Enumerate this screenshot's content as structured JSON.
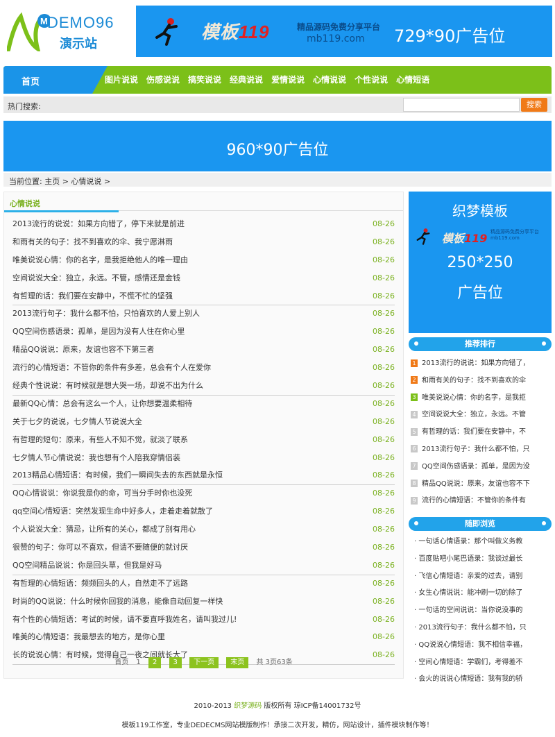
{
  "logo": {
    "brand": "DEMO96",
    "sub": "演示站"
  },
  "top_ad": {
    "mb_prefix": "模板",
    "mb_num": "119",
    "site_line1": "精品源码免费分享平台",
    "site_line2": "mb119.com",
    "size": "729*90广告位"
  },
  "nav": {
    "home": "首页",
    "items": [
      "图片说说",
      "伤感说说",
      "搞笑说说",
      "经典说说",
      "爱情说说",
      "心情说说",
      "个性说说",
      "心情短语"
    ]
  },
  "search": {
    "label": "热门搜索:",
    "button": "搜索"
  },
  "mid_ad": "960*90广告位",
  "breadcrumb": "当前位置: 主页 > 心情说说 >",
  "list": {
    "title": "心情说说",
    "items": [
      {
        "t": "2013流行的说说：如果方向错了，停下来就是前进",
        "d": "08-26"
      },
      {
        "t": "和雨有关的句子：找不到喜欢的伞、我宁愿淋雨",
        "d": "08-26"
      },
      {
        "t": "唯美说说心情：你的名字，是我拒绝他人的唯一理由",
        "d": "08-26"
      },
      {
        "t": "空间说说大全：独立，永远。不管，感情还是金钱",
        "d": "08-26"
      },
      {
        "t": "有哲理的话：我们要在安静中，不慌不忙的坚强",
        "d": "08-26"
      },
      {
        "t": "2013流行句子：我什么都不怕，只怕喜欢的人爱上别人",
        "d": "08-26"
      },
      {
        "t": "QQ空间伤感语录：孤单，是因为没有人住在你心里",
        "d": "08-26"
      },
      {
        "t": "精品QQ说说：原来，友谊也容不下第三者",
        "d": "08-26"
      },
      {
        "t": "流行的心情短语：不管你的条件有多差，总会有个人在爱你",
        "d": "08-26"
      },
      {
        "t": "经典个性说说：有时候就是想大哭一场，却说不出为什么",
        "d": "08-26"
      },
      {
        "t": "最新QQ心情：总会有这么一个人，让你想要温柔相待",
        "d": "08-26"
      },
      {
        "t": "关于七夕的说说，七夕情人节说说大全",
        "d": "08-26"
      },
      {
        "t": "有哲理的短句：原来，有些人不知不觉，就淡了联系",
        "d": "08-26"
      },
      {
        "t": "七夕情人节心情说说：我也想有个人陪我穿情侣装",
        "d": "08-26"
      },
      {
        "t": "2013精品心情短语：有时候，我们一瞬间失去的东西就是永恒",
        "d": "08-26"
      },
      {
        "t": "QQ心情说说：你说我是你的命，可当分手时你也没死",
        "d": "08-26"
      },
      {
        "t": "qq空间心情短语：突然发现生命中好多人，走着走着就散了",
        "d": "08-26"
      },
      {
        "t": "个人说说大全：猜忌，让所有的关心，都成了别有用心",
        "d": "08-26"
      },
      {
        "t": "很赞的句子：你可以不喜欢，但请不要随便的就讨厌",
        "d": "08-26"
      },
      {
        "t": "QQ空间精品说说：你是回头草，但我是好马",
        "d": "08-26"
      },
      {
        "t": "有哲理的心情短语：频频回头的人，自然走不了远路",
        "d": "08-26"
      },
      {
        "t": "时尚的QQ说说：什么时候你回我的消息，能像自动回复一样快",
        "d": "08-26"
      },
      {
        "t": "有个性的心情短语：考试的时候，请不要直呼我姓名，请叫我过儿!",
        "d": "08-26"
      },
      {
        "t": "唯美的心情短语：我最想去的地方，是你心里",
        "d": "08-26"
      },
      {
        "t": "长的说说心情：有时候，觉得自己一夜之间就长大了",
        "d": "08-26"
      }
    ]
  },
  "pager": {
    "first": "首页",
    "p1": "1",
    "p2": "2",
    "p3": "3",
    "next": "下一页",
    "last": "末页",
    "total": "共 3页63条"
  },
  "side_ad": {
    "t1": "织梦模板",
    "mb_prefix": "模板",
    "mb_num": "119",
    "s1": "精品源码免费分享平台",
    "s2": "mb119.com",
    "t2": "250*250",
    "t3": "广告位"
  },
  "rank": {
    "title": "推荐排行",
    "items": [
      "2013流行的说说：如果方向错了，",
      "和雨有关的句子：找不到喜欢的伞",
      "唯美说说心情：你的名字，是我拒",
      "空间说说大全：独立，永远。不管",
      "有哲理的话：我们要在安静中，不",
      "2013流行句子：我什么都不怕，只",
      "QQ空间伤感语录：孤单，是因为没",
      "精品QQ说说：原来，友谊也容不下",
      "流行的心情短语：不管你的条件有"
    ]
  },
  "random": {
    "title": "随即浏览",
    "items": [
      "· 一句话心情语录：那个叫做义务教",
      "· 百度贴吧小尾巴语录：我谈过最长",
      "· 飞信心情短语：亲爱的过去，请别",
      "· 女生心情说说：能冲刷一切的除了",
      "· 一句话的空间说说：当你说没事的",
      "· 2013流行句子：我什么都不怕，只",
      "· QQ说说心情短语：我不相信幸福，",
      "· 空间心情短语：学霸们，考得差不",
      "· 会火的说说心情短语：我有我的骄"
    ]
  },
  "footer": {
    "line1_pre": "2010-2013",
    "line1_link": "织梦源码",
    "line1_post": "版权所有 琼ICP备14001732号",
    "line2": "模板119工作室，专业DEDECMS网站模版制作！承接二次开发，精仿，网站设计，插件模块制作等！"
  },
  "colors": {
    "accent_blue": "#1a96f0",
    "accent_green": "#7cc019",
    "orange": "#f07a18"
  }
}
